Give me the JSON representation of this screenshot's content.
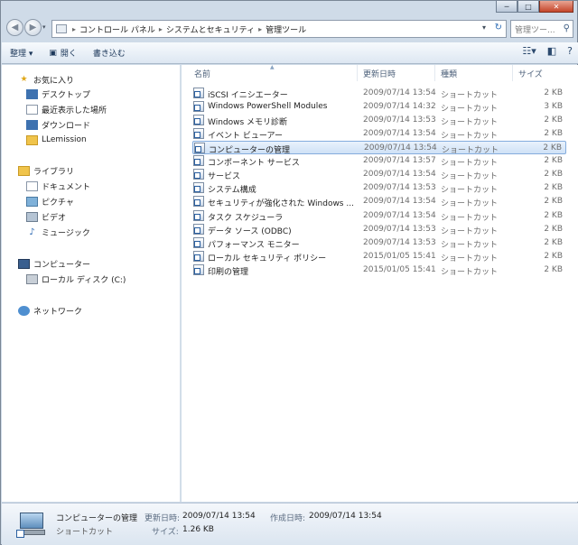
{
  "window": {
    "controls": {
      "minimize": "─",
      "maximize": "□",
      "close": "✕"
    }
  },
  "address": {
    "segments": [
      "コントロール パネル",
      "システムとセキュリティ",
      "管理ツール"
    ],
    "search_placeholder": "管理ツー..."
  },
  "toolbar": {
    "organize": "整理 ▾",
    "open": "開く",
    "burn": "書き込む"
  },
  "navpane": {
    "favorites_header": "お気に入り",
    "favorites": [
      "デスクトップ",
      "最近表示した場所",
      "ダウンロード",
      "LLemission"
    ],
    "libraries_header": "ライブラリ",
    "libraries": [
      "ドキュメント",
      "ピクチャ",
      "ビデオ",
      "ミュージック"
    ],
    "computer_header": "コンピューター",
    "computer": [
      "ローカル ディスク (C:)"
    ],
    "network_header": "ネットワーク"
  },
  "columns": {
    "name": "名前",
    "date": "更新日時",
    "type": "種類",
    "size": "サイズ"
  },
  "files": [
    {
      "name": "iSCSI イニシエーター",
      "date": "2009/07/14 13:54",
      "type": "ショートカット",
      "size": "2 KB"
    },
    {
      "name": "Windows PowerShell Modules",
      "date": "2009/07/14 14:32",
      "type": "ショートカット",
      "size": "3 KB"
    },
    {
      "name": "Windows メモリ診断",
      "date": "2009/07/14 13:53",
      "type": "ショートカット",
      "size": "2 KB"
    },
    {
      "name": "イベント ビューアー",
      "date": "2009/07/14 13:54",
      "type": "ショートカット",
      "size": "2 KB"
    },
    {
      "name": "コンピューターの管理",
      "date": "2009/07/14 13:54",
      "type": "ショートカット",
      "size": "2 KB"
    },
    {
      "name": "コンポーネント サービス",
      "date": "2009/07/14 13:57",
      "type": "ショートカット",
      "size": "2 KB"
    },
    {
      "name": "サービス",
      "date": "2009/07/14 13:54",
      "type": "ショートカット",
      "size": "2 KB"
    },
    {
      "name": "システム構成",
      "date": "2009/07/14 13:53",
      "type": "ショートカット",
      "size": "2 KB"
    },
    {
      "name": "セキュリティが強化された Windows ...",
      "date": "2009/07/14 13:54",
      "type": "ショートカット",
      "size": "2 KB"
    },
    {
      "name": "タスク スケジューラ",
      "date": "2009/07/14 13:54",
      "type": "ショートカット",
      "size": "2 KB"
    },
    {
      "name": "データ ソース (ODBC)",
      "date": "2009/07/14 13:53",
      "type": "ショートカット",
      "size": "2 KB"
    },
    {
      "name": "パフォーマンス モニター",
      "date": "2009/07/14 13:53",
      "type": "ショートカット",
      "size": "2 KB"
    },
    {
      "name": "ローカル セキュリティ ポリシー",
      "date": "2015/01/05 15:41",
      "type": "ショートカット",
      "size": "2 KB"
    },
    {
      "name": "印刷の管理",
      "date": "2015/01/05 15:41",
      "type": "ショートカット",
      "size": "2 KB"
    }
  ],
  "details": {
    "name": "コンピューターの管理",
    "type": "ショートカット",
    "modified_label": "更新日時:",
    "modified_value": "2009/07/14 13:54",
    "size_label": "サイズ:",
    "size_value": "1.26 KB",
    "created_label": "作成日時:",
    "created_value": "2009/07/14 13:54"
  }
}
